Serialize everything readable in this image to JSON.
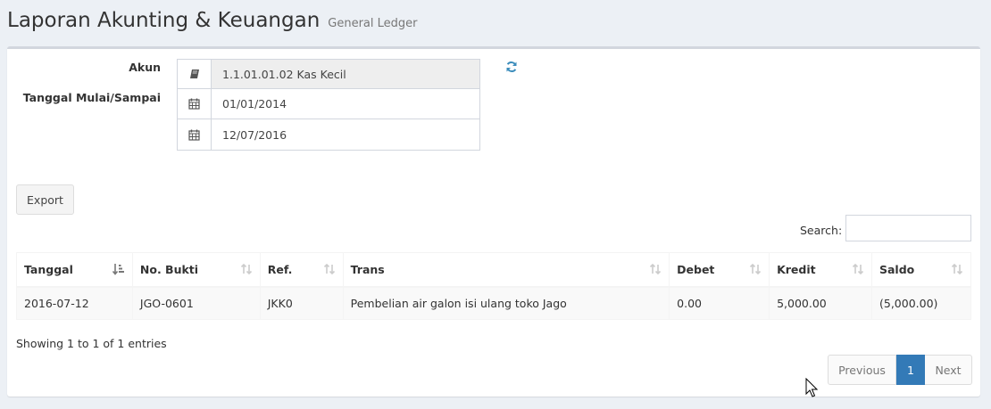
{
  "header": {
    "title": "Laporan Akunting & Keuangan",
    "subtitle": "General Ledger"
  },
  "form": {
    "akun_label": "Akun",
    "akun_value": "1.1.01.01.02 Kas Kecil",
    "tanggal_label": "Tanggal Mulai/Sampai",
    "tanggal_mulai": "01/01/2014",
    "tanggal_sampai": "12/07/2016"
  },
  "toolbar": {
    "export_label": "Export",
    "search_label": "Search:",
    "search_value": ""
  },
  "table": {
    "columns": [
      "Tanggal",
      "No. Bukti",
      "Ref.",
      "Trans",
      "Debet",
      "Kredit",
      "Saldo"
    ],
    "rows": [
      [
        "2016-07-12",
        "JGO-0601",
        "JKK0",
        "Pembelian air galon isi ulang toko Jago",
        "0.00",
        "5,000.00",
        "(5,000.00)"
      ]
    ]
  },
  "footer": {
    "info": "Showing 1 to 1 of 1 entries",
    "previous": "Previous",
    "page": "1",
    "next": "Next"
  },
  "colors": {
    "background": "#ecf0f5",
    "accent": "#337ab7",
    "refresh_icon": "#3c8dbc"
  },
  "icons": {
    "akun": "book-icon",
    "tanggal": "calendar-icon",
    "refresh": "refresh-icon",
    "sort_active": "sort-amount-asc-icon",
    "sort": "sort-icon"
  }
}
